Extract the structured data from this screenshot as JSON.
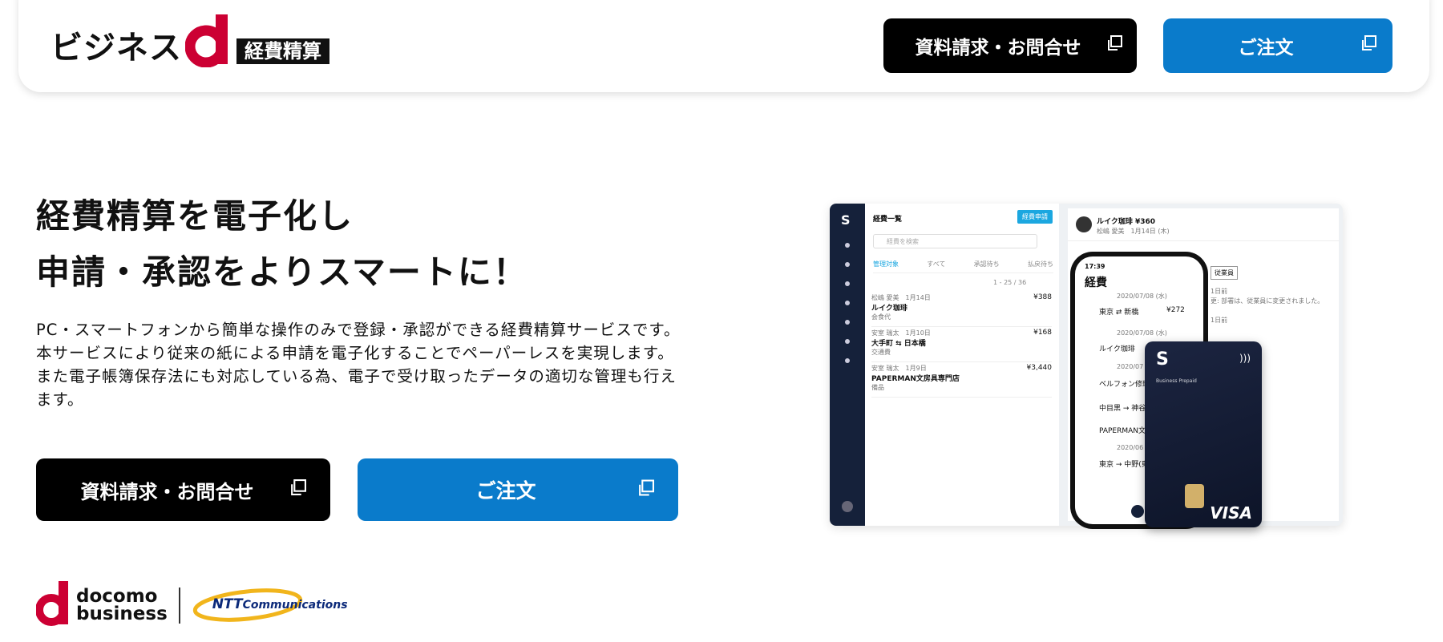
{
  "header": {
    "logo": {
      "text": "ビジネス",
      "letter": "d",
      "badge": "経費精算"
    },
    "buttons": {
      "inquiry": "資料請求・お問合せ",
      "order": "ご注文"
    }
  },
  "hero": {
    "title_line1": "経費精算を電子化し",
    "title_line2": "申請・承認をよりスマートに！",
    "desc_line1": "PC・スマートフォンから簡単な操作のみで登録・承認ができる経費精算サービスです。",
    "desc_line2": "本サービスにより従来の紙による申請を電子化することでペーパーレスを実現します。",
    "desc_line3": "また電子帳簿保存法にも対応している為、電子で受け取ったデータの適切な管理も行え",
    "desc_line4": "ます。",
    "buttons": {
      "inquiry": "資料請求・お問合せ",
      "order": "ご注文"
    }
  },
  "footer": {
    "docomo_line1": "docomo",
    "docomo_line2": "business",
    "ntt_prefix": "NTT",
    "ntt_suffix": "Communications"
  },
  "mockup": {
    "list_title": "経費一覧",
    "apply_button": "経費申請",
    "search_placeholder": "経費を検索",
    "tabs": [
      "管理対象",
      "すべて",
      "承認待ち",
      "払戻待ち"
    ],
    "pager": "1 - 25 / 36",
    "rows": [
      {
        "meta": "松嶋 愛美　1月14日",
        "title": "ルイク珈琲",
        "sub": "会食代",
        "amount": "¥388"
      },
      {
        "meta": "安室 瑞太　1月10日",
        "title": "大手町 ⇆ 日本橋",
        "sub": "交通費",
        "amount": "¥168"
      },
      {
        "meta": "安室 瑞太　1月9日",
        "title": "PAPERMAN文房具専門店",
        "sub": "備品",
        "amount": "¥3,440"
      }
    ],
    "detail_title": "ルイク珈琲 ¥360",
    "detail_sub": "松嶋 愛美　1月14日 (木)",
    "detail_badge": "従業員",
    "detail_line1": "1日前",
    "detail_line2": "更: 部署は、従業員に変更されました。",
    "detail_line3": "1日前",
    "phone": {
      "time": "17:39",
      "title": "経費",
      "date1": "2020/07/08 (水)",
      "item1": "東京 ⇄ 新橋",
      "item1_amount": "¥272",
      "date2": "2020/07/08 (水)",
      "item2": "ルイク珈琲",
      "date3": "2020/07",
      "item3": "ベルフォン修理",
      "item4": "中目黒 → 神谷町",
      "item5": "PAPERMAN文",
      "date4": "2020/06",
      "item6": "東京 → 中野(東京"
    },
    "card": {
      "label": "Business Prepaid",
      "brand": "VISA"
    }
  }
}
